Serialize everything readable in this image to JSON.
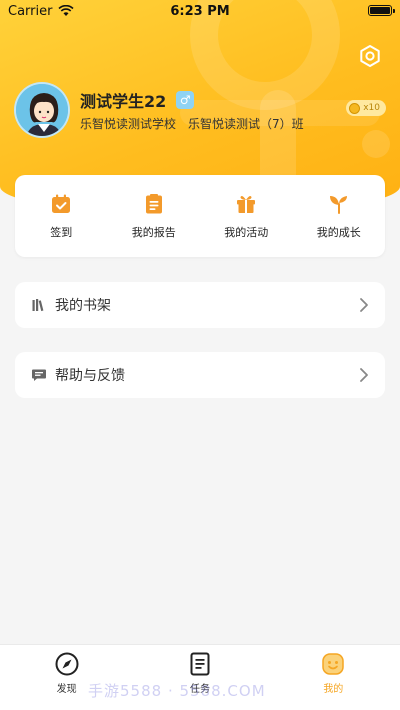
{
  "status": {
    "carrier": "Carrier",
    "time": "6:23 PM"
  },
  "profile": {
    "name": "测试学生22",
    "gender_symbol": "♂",
    "school": "乐智悦读测试学校　乐智悦读测试（7）班",
    "coin_count": "x10"
  },
  "quick_actions": [
    {
      "label": "签到",
      "icon": "calendar-check-icon"
    },
    {
      "label": "我的报告",
      "icon": "report-icon"
    },
    {
      "label": "我的活动",
      "icon": "gift-icon"
    },
    {
      "label": "我的成长",
      "icon": "sprout-icon"
    }
  ],
  "menu": {
    "bookshelf": {
      "label": "我的书架",
      "icon": "bookshelf-icon"
    },
    "feedback": {
      "label": "帮助与反馈",
      "icon": "chat-bubble-icon"
    }
  },
  "tabs": [
    {
      "label": "发现",
      "icon": "compass-icon",
      "active": false
    },
    {
      "label": "任务",
      "icon": "checklist-icon",
      "active": false
    },
    {
      "label": "我的",
      "icon": "smiley-face-icon",
      "active": true
    }
  ],
  "watermark": "手游5588 · 5588.COM",
  "colors": {
    "accent": "#f5a623",
    "header": "#ffc323",
    "icon_orange": "#f39a2b"
  }
}
